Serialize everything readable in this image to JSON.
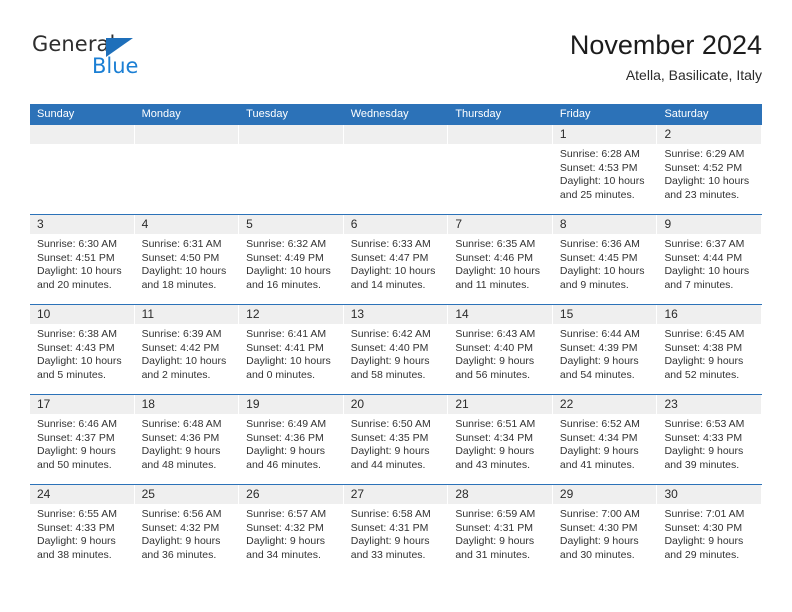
{
  "brand": {
    "name_part1": "General",
    "name_part2": "Blue",
    "triangle_color": "#1e6fba",
    "blue_color": "#1b7fd4"
  },
  "header": {
    "title": "November 2024",
    "subtitle": "Atella, Basilicate, Italy",
    "weekday_bar_color": "#2c72b8",
    "weekdays": [
      "Sunday",
      "Monday",
      "Tuesday",
      "Wednesday",
      "Thursday",
      "Friday",
      "Saturday"
    ]
  },
  "calendar": {
    "weeks": [
      [
        {
          "day": "",
          "empty": true
        },
        {
          "day": "",
          "empty": true
        },
        {
          "day": "",
          "empty": true
        },
        {
          "day": "",
          "empty": true
        },
        {
          "day": "",
          "empty": true
        },
        {
          "day": "1",
          "sunrise": "Sunrise: 6:28 AM",
          "sunset": "Sunset: 4:53 PM",
          "daylight1": "Daylight: 10 hours",
          "daylight2": "and 25 minutes."
        },
        {
          "day": "2",
          "sunrise": "Sunrise: 6:29 AM",
          "sunset": "Sunset: 4:52 PM",
          "daylight1": "Daylight: 10 hours",
          "daylight2": "and 23 minutes."
        }
      ],
      [
        {
          "day": "3",
          "sunrise": "Sunrise: 6:30 AM",
          "sunset": "Sunset: 4:51 PM",
          "daylight1": "Daylight: 10 hours",
          "daylight2": "and 20 minutes."
        },
        {
          "day": "4",
          "sunrise": "Sunrise: 6:31 AM",
          "sunset": "Sunset: 4:50 PM",
          "daylight1": "Daylight: 10 hours",
          "daylight2": "and 18 minutes."
        },
        {
          "day": "5",
          "sunrise": "Sunrise: 6:32 AM",
          "sunset": "Sunset: 4:49 PM",
          "daylight1": "Daylight: 10 hours",
          "daylight2": "and 16 minutes."
        },
        {
          "day": "6",
          "sunrise": "Sunrise: 6:33 AM",
          "sunset": "Sunset: 4:47 PM",
          "daylight1": "Daylight: 10 hours",
          "daylight2": "and 14 minutes."
        },
        {
          "day": "7",
          "sunrise": "Sunrise: 6:35 AM",
          "sunset": "Sunset: 4:46 PM",
          "daylight1": "Daylight: 10 hours",
          "daylight2": "and 11 minutes."
        },
        {
          "day": "8",
          "sunrise": "Sunrise: 6:36 AM",
          "sunset": "Sunset: 4:45 PM",
          "daylight1": "Daylight: 10 hours",
          "daylight2": "and 9 minutes."
        },
        {
          "day": "9",
          "sunrise": "Sunrise: 6:37 AM",
          "sunset": "Sunset: 4:44 PM",
          "daylight1": "Daylight: 10 hours",
          "daylight2": "and 7 minutes."
        }
      ],
      [
        {
          "day": "10",
          "sunrise": "Sunrise: 6:38 AM",
          "sunset": "Sunset: 4:43 PM",
          "daylight1": "Daylight: 10 hours",
          "daylight2": "and 5 minutes."
        },
        {
          "day": "11",
          "sunrise": "Sunrise: 6:39 AM",
          "sunset": "Sunset: 4:42 PM",
          "daylight1": "Daylight: 10 hours",
          "daylight2": "and 2 minutes."
        },
        {
          "day": "12",
          "sunrise": "Sunrise: 6:41 AM",
          "sunset": "Sunset: 4:41 PM",
          "daylight1": "Daylight: 10 hours",
          "daylight2": "and 0 minutes."
        },
        {
          "day": "13",
          "sunrise": "Sunrise: 6:42 AM",
          "sunset": "Sunset: 4:40 PM",
          "daylight1": "Daylight: 9 hours",
          "daylight2": "and 58 minutes."
        },
        {
          "day": "14",
          "sunrise": "Sunrise: 6:43 AM",
          "sunset": "Sunset: 4:40 PM",
          "daylight1": "Daylight: 9 hours",
          "daylight2": "and 56 minutes."
        },
        {
          "day": "15",
          "sunrise": "Sunrise: 6:44 AM",
          "sunset": "Sunset: 4:39 PM",
          "daylight1": "Daylight: 9 hours",
          "daylight2": "and 54 minutes."
        },
        {
          "day": "16",
          "sunrise": "Sunrise: 6:45 AM",
          "sunset": "Sunset: 4:38 PM",
          "daylight1": "Daylight: 9 hours",
          "daylight2": "and 52 minutes."
        }
      ],
      [
        {
          "day": "17",
          "sunrise": "Sunrise: 6:46 AM",
          "sunset": "Sunset: 4:37 PM",
          "daylight1": "Daylight: 9 hours",
          "daylight2": "and 50 minutes."
        },
        {
          "day": "18",
          "sunrise": "Sunrise: 6:48 AM",
          "sunset": "Sunset: 4:36 PM",
          "daylight1": "Daylight: 9 hours",
          "daylight2": "and 48 minutes."
        },
        {
          "day": "19",
          "sunrise": "Sunrise: 6:49 AM",
          "sunset": "Sunset: 4:36 PM",
          "daylight1": "Daylight: 9 hours",
          "daylight2": "and 46 minutes."
        },
        {
          "day": "20",
          "sunrise": "Sunrise: 6:50 AM",
          "sunset": "Sunset: 4:35 PM",
          "daylight1": "Daylight: 9 hours",
          "daylight2": "and 44 minutes."
        },
        {
          "day": "21",
          "sunrise": "Sunrise: 6:51 AM",
          "sunset": "Sunset: 4:34 PM",
          "daylight1": "Daylight: 9 hours",
          "daylight2": "and 43 minutes."
        },
        {
          "day": "22",
          "sunrise": "Sunrise: 6:52 AM",
          "sunset": "Sunset: 4:34 PM",
          "daylight1": "Daylight: 9 hours",
          "daylight2": "and 41 minutes."
        },
        {
          "day": "23",
          "sunrise": "Sunrise: 6:53 AM",
          "sunset": "Sunset: 4:33 PM",
          "daylight1": "Daylight: 9 hours",
          "daylight2": "and 39 minutes."
        }
      ],
      [
        {
          "day": "24",
          "sunrise": "Sunrise: 6:55 AM",
          "sunset": "Sunset: 4:33 PM",
          "daylight1": "Daylight: 9 hours",
          "daylight2": "and 38 minutes."
        },
        {
          "day": "25",
          "sunrise": "Sunrise: 6:56 AM",
          "sunset": "Sunset: 4:32 PM",
          "daylight1": "Daylight: 9 hours",
          "daylight2": "and 36 minutes."
        },
        {
          "day": "26",
          "sunrise": "Sunrise: 6:57 AM",
          "sunset": "Sunset: 4:32 PM",
          "daylight1": "Daylight: 9 hours",
          "daylight2": "and 34 minutes."
        },
        {
          "day": "27",
          "sunrise": "Sunrise: 6:58 AM",
          "sunset": "Sunset: 4:31 PM",
          "daylight1": "Daylight: 9 hours",
          "daylight2": "and 33 minutes."
        },
        {
          "day": "28",
          "sunrise": "Sunrise: 6:59 AM",
          "sunset": "Sunset: 4:31 PM",
          "daylight1": "Daylight: 9 hours",
          "daylight2": "and 31 minutes."
        },
        {
          "day": "29",
          "sunrise": "Sunrise: 7:00 AM",
          "sunset": "Sunset: 4:30 PM",
          "daylight1": "Daylight: 9 hours",
          "daylight2": "and 30 minutes."
        },
        {
          "day": "30",
          "sunrise": "Sunrise: 7:01 AM",
          "sunset": "Sunset: 4:30 PM",
          "daylight1": "Daylight: 9 hours",
          "daylight2": "and 29 minutes."
        }
      ]
    ]
  }
}
